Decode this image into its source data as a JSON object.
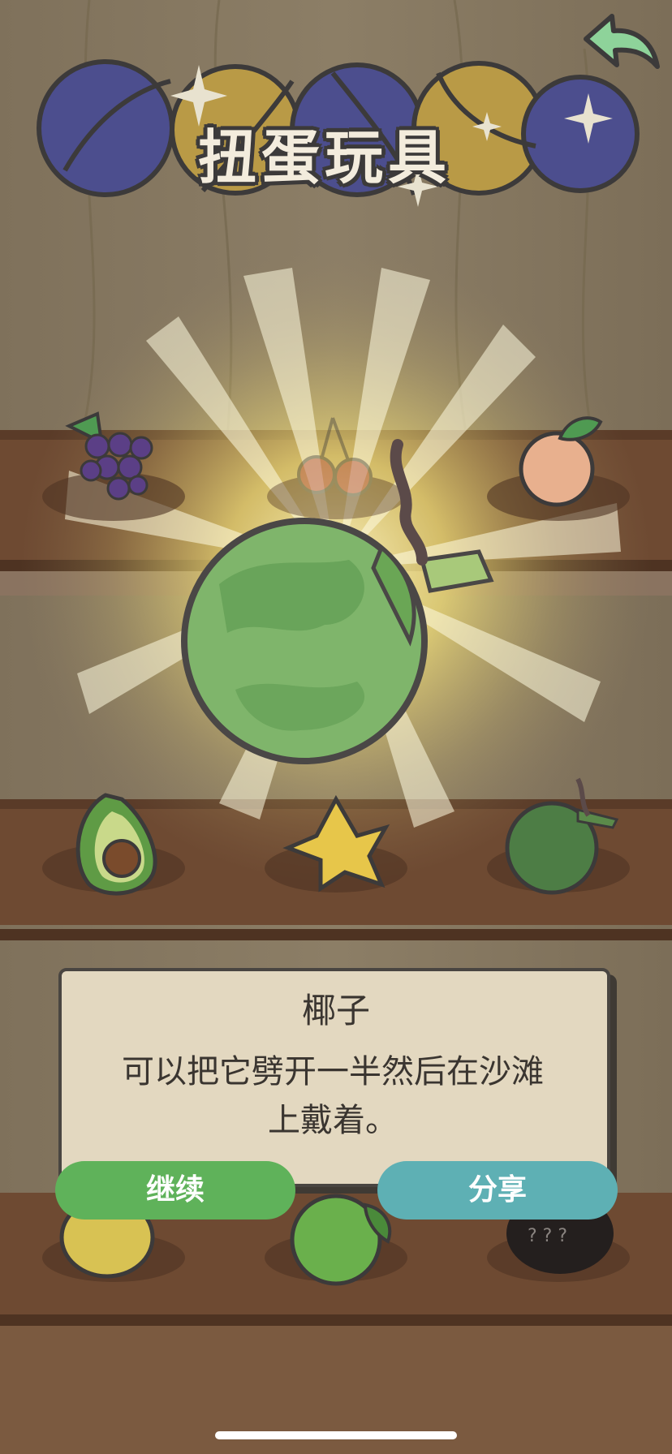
{
  "header": {
    "title": "扭蛋玩具",
    "back_icon": "back-arrow-icon"
  },
  "reveal": {
    "item_icon": "coconut-icon",
    "effect": "glow-burst"
  },
  "shelf": {
    "items": [
      {
        "icon": "grape-icon"
      },
      {
        "icon": "cherry-icon"
      },
      {
        "icon": "peach-icon"
      },
      {
        "icon": "avocado-icon"
      },
      {
        "icon": "starfruit-icon"
      },
      {
        "icon": "coconut-icon"
      },
      {
        "icon": "lemon-icon"
      },
      {
        "icon": "lime-icon"
      },
      {
        "icon": "locked-item-icon"
      }
    ]
  },
  "dialog": {
    "name": "椰子",
    "description_line1": "可以把它劈开一半然后在沙滩",
    "description_line2": "上戴着。",
    "continue_label": "继续",
    "share_label": "分享"
  },
  "colors": {
    "continue": "#5fb25a",
    "share": "#5eb0b4",
    "card": "#e3d8c0",
    "back_arrow": "#8ed39a"
  }
}
